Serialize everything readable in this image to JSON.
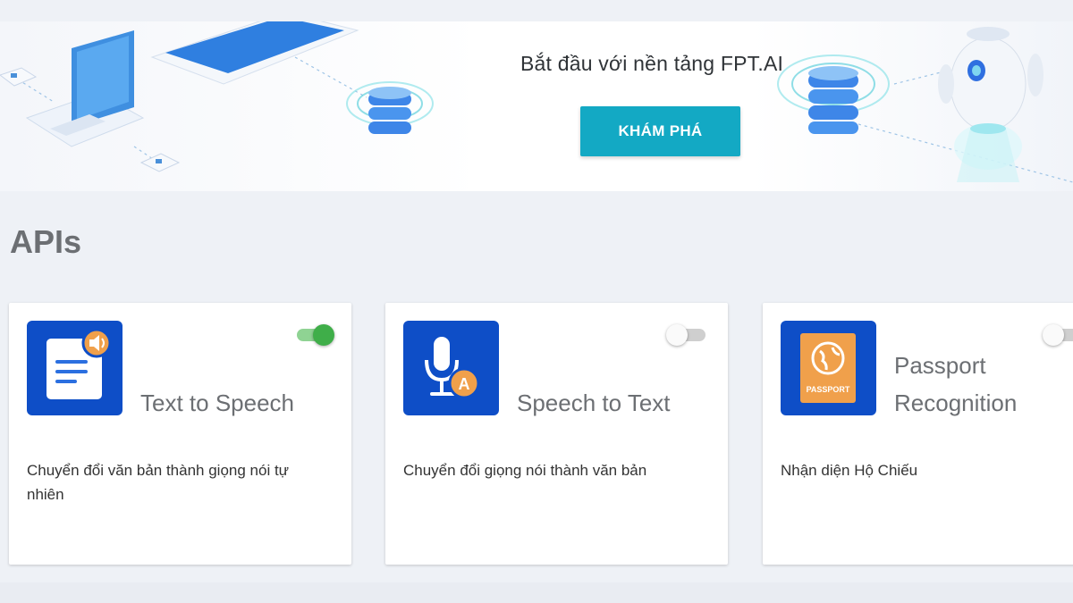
{
  "banner": {
    "title": "Bắt đầu với nền tảng FPT.AI",
    "button_label": "KHÁM PHÁ"
  },
  "section": {
    "title": "APIs"
  },
  "cards": [
    {
      "name": "Text to Speech",
      "description": "Chuyển đổi văn bản thành giọng nói tự nhiên",
      "icon": "document-speaker-icon",
      "enabled": true
    },
    {
      "name": "Speech to Text",
      "description": "Chuyển đổi giọng nói thành văn bản",
      "icon": "microphone-text-icon",
      "enabled": false
    },
    {
      "name_line1": "Passport",
      "name_line2": "Recognition",
      "description": "Nhận diện Hộ Chiếu",
      "icon": "passport-icon",
      "icon_label": "PASSPORT",
      "enabled": false
    }
  ],
  "colors": {
    "accent": "#13a9c4",
    "icon_bg": "#0e4ec7",
    "toggle_on": "#3fae49",
    "icon_badge": "#f0a04b"
  }
}
